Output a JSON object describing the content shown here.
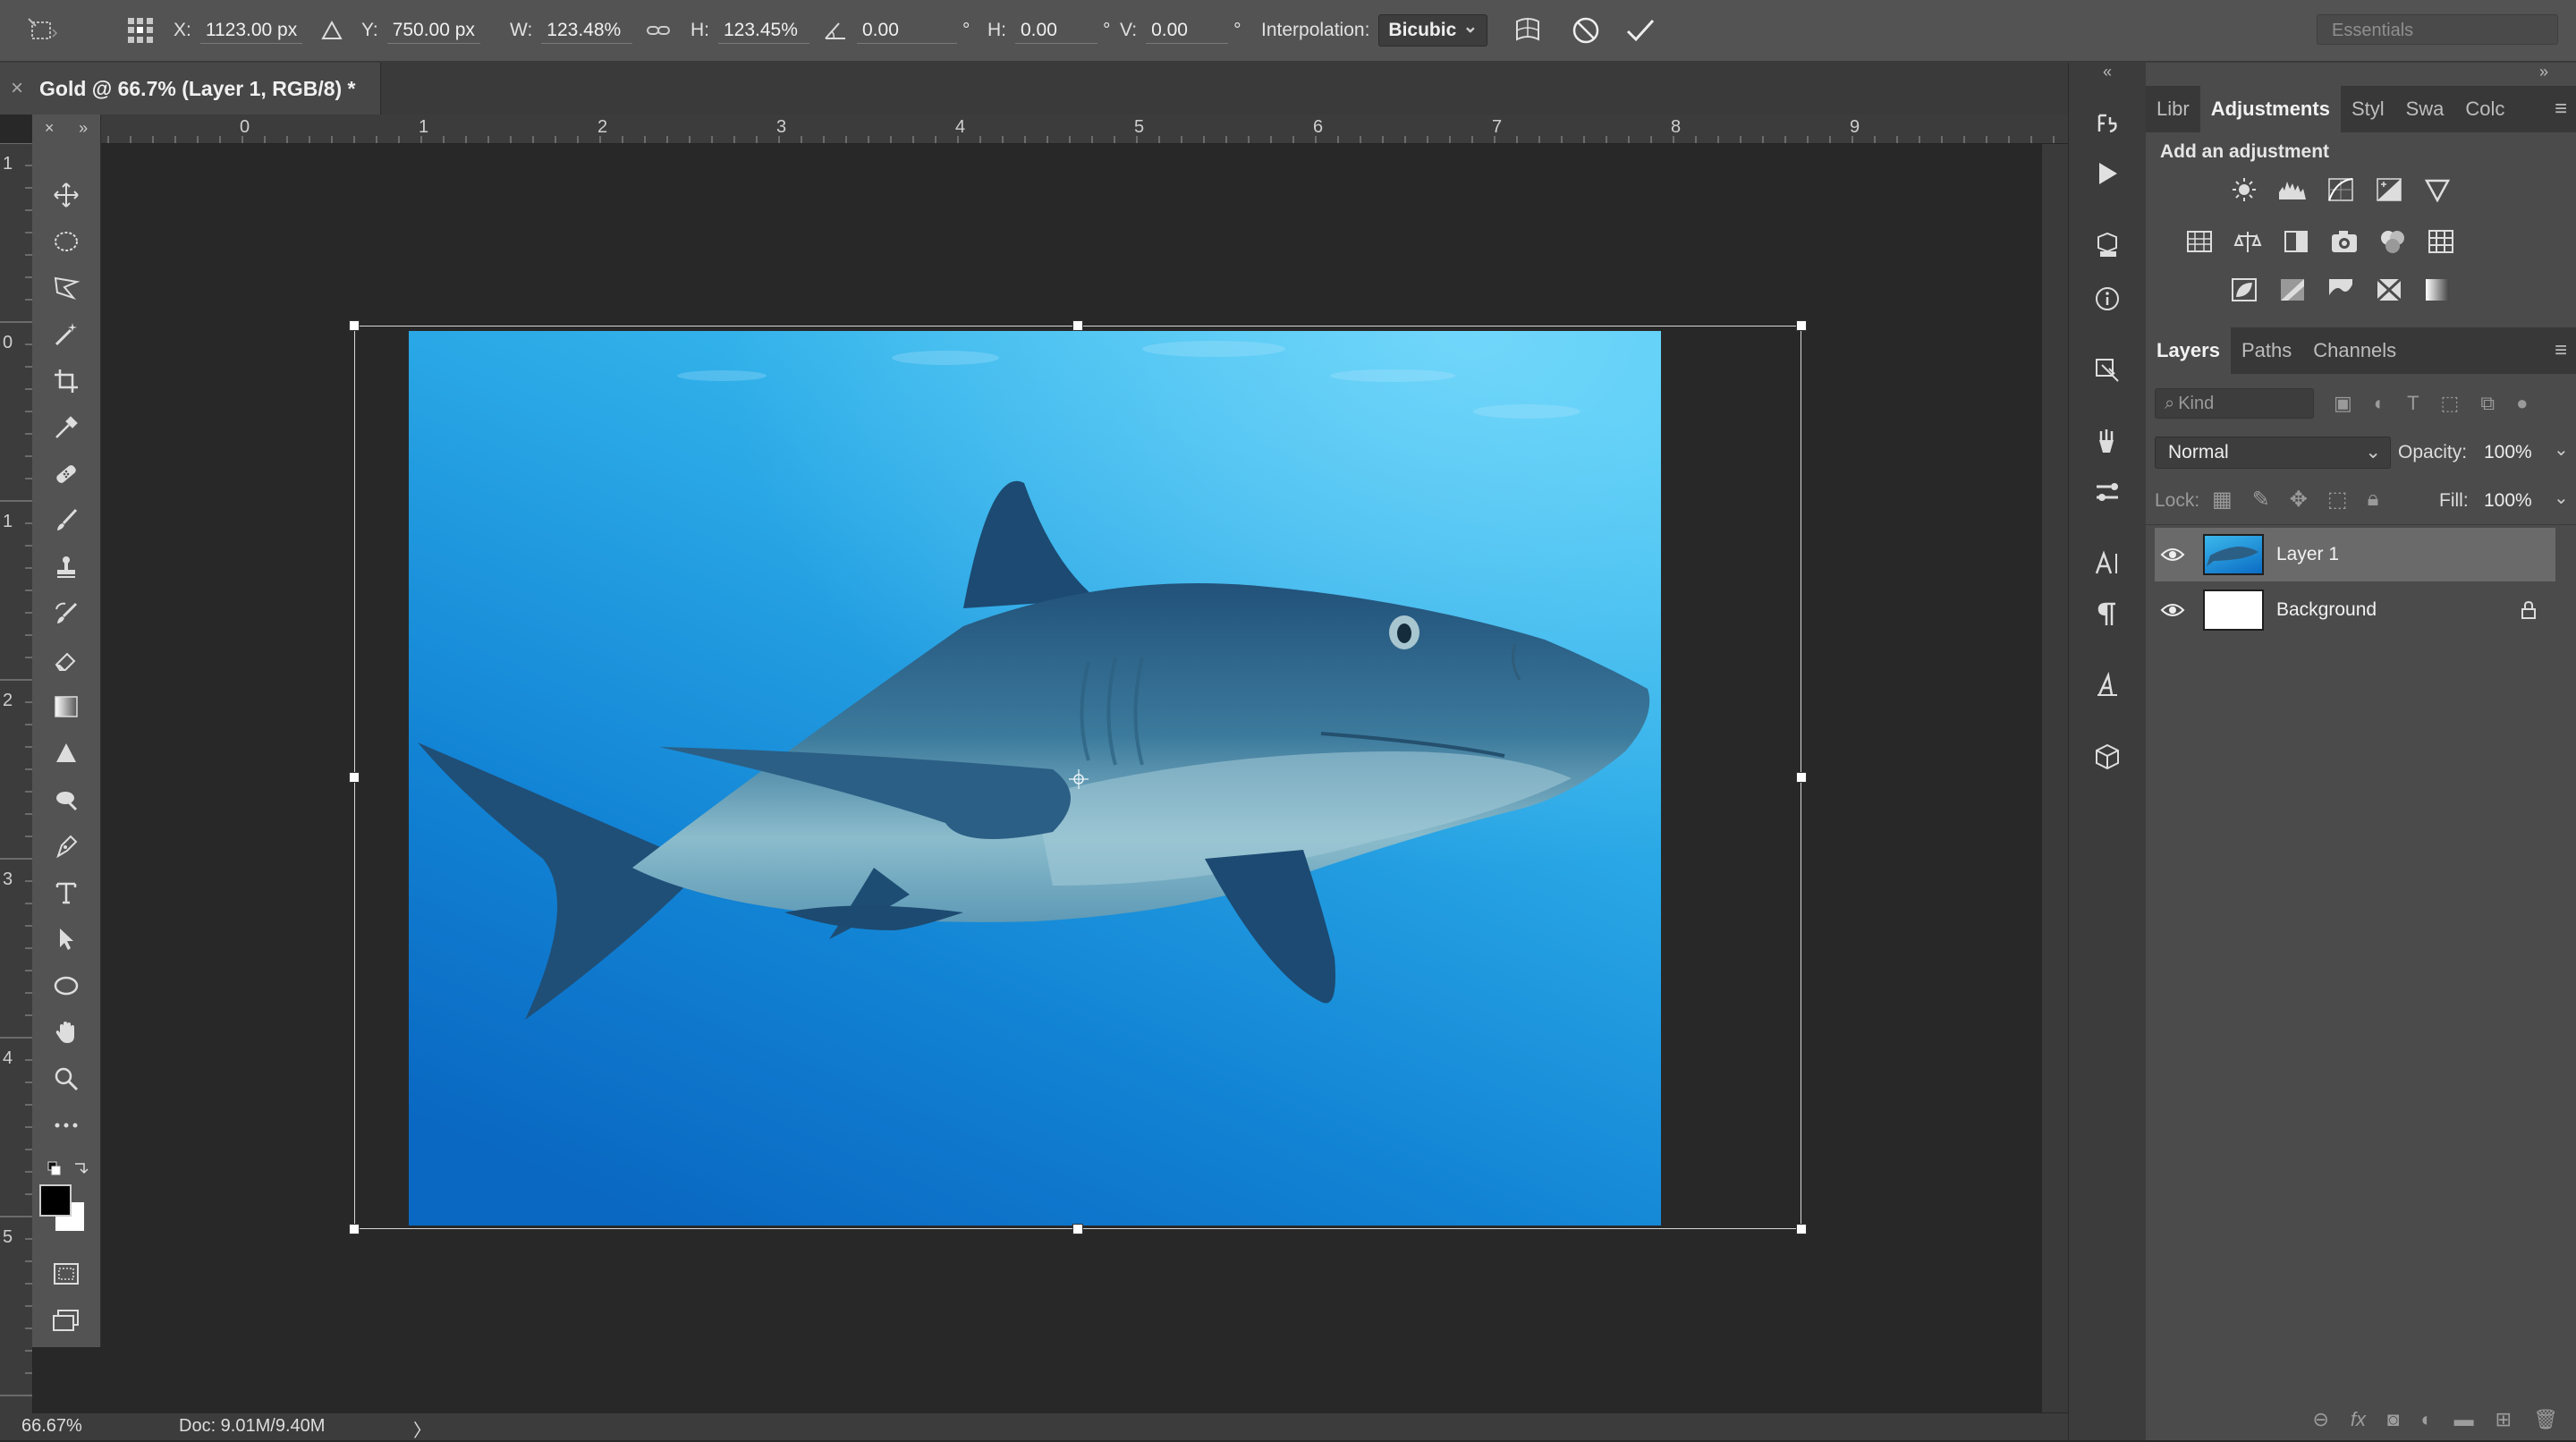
{
  "options_bar": {
    "x_label": "X:",
    "x_value": "1123.00 px",
    "y_label": "Y:",
    "y_value": "750.00 px",
    "w_label": "W:",
    "w_value": "123.48%",
    "h_label": "H:",
    "h_value": "123.45%",
    "angle_value": "0.00",
    "angle_unit": "°",
    "hskew_label": "H:",
    "hskew_value": "0.00",
    "hskew_unit": "°",
    "vskew_label": "V:",
    "vskew_value": "0.00",
    "vskew_unit": "°",
    "interpolation_label": "Interpolation:",
    "interpolation_value": "Bicubic",
    "workspace": "Essentials"
  },
  "document": {
    "tab_title": "Gold @ 66.7% (Layer 1, RGB/8) *",
    "close_glyph": "×"
  },
  "ruler": {
    "top_numbers": [
      "1",
      "0",
      "1",
      "2",
      "3",
      "4",
      "5",
      "6",
      "7",
      "8",
      "9"
    ],
    "left_numbers": [
      "1",
      "0",
      "1",
      "2",
      "3",
      "4",
      "5"
    ]
  },
  "status_bar": {
    "zoom": "66.67%",
    "doc_size": "Doc: 9.01M/9.40M",
    "arrow": "〉"
  },
  "panels": {
    "top_tabs": [
      "Libr",
      "Adjustments",
      "Styl",
      "Swa",
      "Colc"
    ],
    "active_top_tab": "Adjustments",
    "add_adjustment_label": "Add an adjustment",
    "layer_tabs": [
      "Layers",
      "Paths",
      "Channels"
    ],
    "active_layer_tab": "Layers",
    "kind_placeholder": "Kind",
    "blend_mode": "Normal",
    "opacity_label": "Opacity:",
    "opacity_value": "100%",
    "lock_label": "Lock:",
    "fill_label": "Fill:",
    "fill_value": "100%",
    "layers": [
      {
        "name": "Layer 1",
        "selected": true
      },
      {
        "name": "Background",
        "selected": false,
        "locked": true
      }
    ]
  },
  "colors": {
    "ocean_top": "#2fb6ea",
    "ocean_bottom": "#0a67c0",
    "shark_dark": "#1e4f75",
    "shark_light": "#7fb0c4"
  }
}
